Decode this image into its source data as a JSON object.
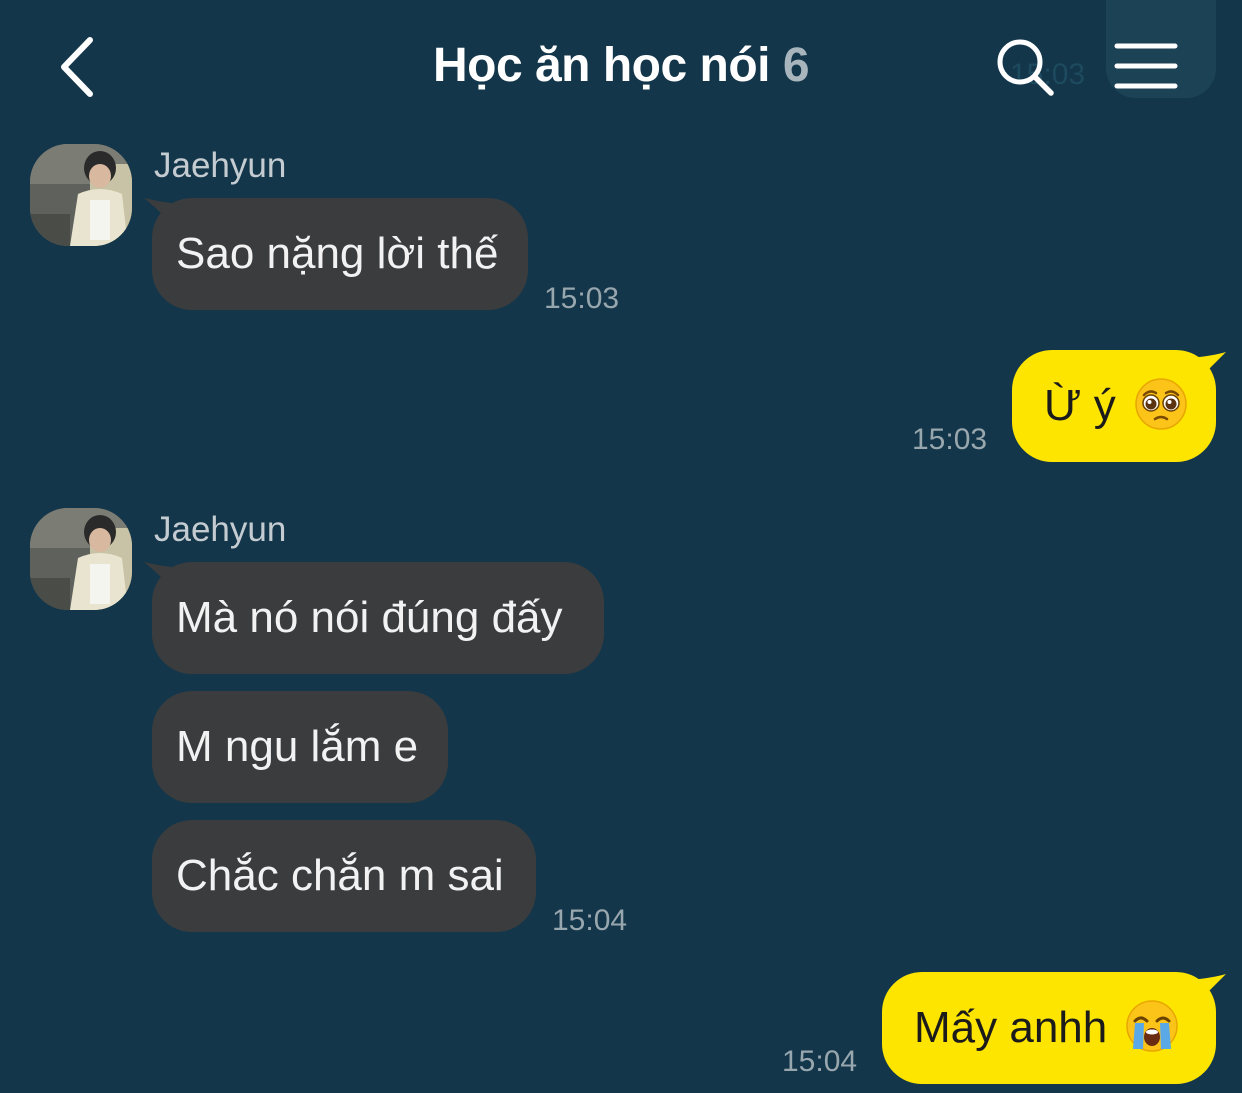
{
  "header": {
    "title": "Học ăn học nói",
    "member_count": "6",
    "ghost_time": "15:03"
  },
  "messages": [
    {
      "sender": "Jaehyun",
      "text": "Sao nặng lời thế",
      "time": "15:03"
    },
    {
      "sender": "me",
      "text": "Ừ ý",
      "emoji": "pleading-face-icon",
      "time": "15:03"
    },
    {
      "sender": "Jaehyun",
      "text": "Mà nó nói đúng đấy"
    },
    {
      "sender": "Jaehyun",
      "text": "M ngu lắm e"
    },
    {
      "sender": "Jaehyun",
      "text": "Chắc chắn m sai",
      "time": "15:04"
    },
    {
      "sender": "me",
      "text": "Mấy anhh",
      "emoji": "loudly-crying-face-icon",
      "time": "15:04"
    }
  ],
  "colors": {
    "background": "#13364a",
    "incoming_bubble": "#3b3c3e",
    "outgoing_bubble": "#fee500",
    "timestamp": "#98a6ae"
  }
}
